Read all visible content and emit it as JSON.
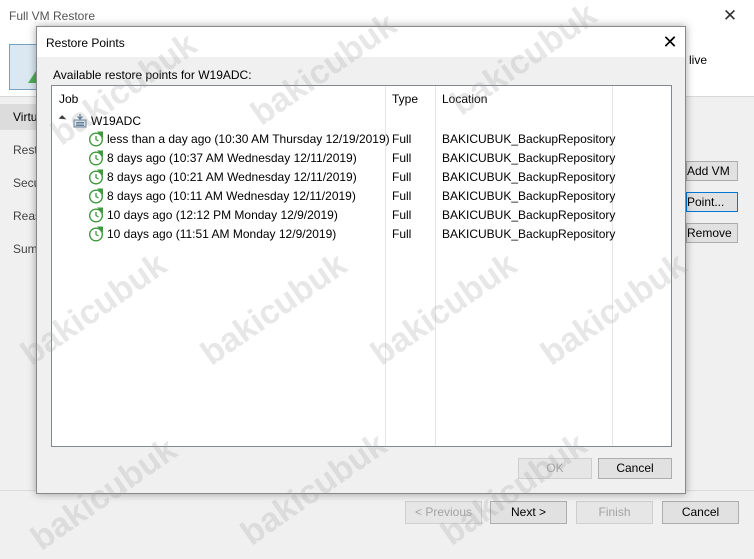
{
  "window": {
    "title": "Full VM Restore",
    "header_text": "live",
    "steps": [
      "Virtual",
      "Restore",
      "Secure",
      "Reason",
      "Summary"
    ],
    "side_buttons": [
      "Add VM",
      "Point...",
      "Remove"
    ],
    "footer_buttons": {
      "previous": "< Previous",
      "next": "Next >",
      "finish": "Finish",
      "cancel": "Cancel"
    }
  },
  "dialog": {
    "title": "Restore Points",
    "label": "Available restore points for W19ADC:",
    "columns": {
      "job": "Job",
      "type": "Type",
      "location": "Location"
    },
    "root": "W19ADC",
    "rows": [
      {
        "name": "less than a day ago (10:30 AM Thursday 12/19/2019)",
        "type": "Full",
        "location": "BAKICUBUK_BackupRepository"
      },
      {
        "name": "8 days ago (10:37 AM Wednesday 12/11/2019)",
        "type": "Full",
        "location": "BAKICUBUK_BackupRepository"
      },
      {
        "name": "8 days ago (10:21 AM Wednesday 12/11/2019)",
        "type": "Full",
        "location": "BAKICUBUK_BackupRepository"
      },
      {
        "name": "8 days ago (10:11 AM Wednesday 12/11/2019)",
        "type": "Full",
        "location": "BAKICUBUK_BackupRepository"
      },
      {
        "name": "10 days ago (12:12 PM Monday 12/9/2019)",
        "type": "Full",
        "location": "BAKICUBUK_BackupRepository"
      },
      {
        "name": "10 days ago (11:51 AM Monday 12/9/2019)",
        "type": "Full",
        "location": "BAKICUBUK_BackupRepository"
      }
    ],
    "ok": "OK",
    "cancel": "Cancel"
  },
  "watermark": "bakicubuk"
}
